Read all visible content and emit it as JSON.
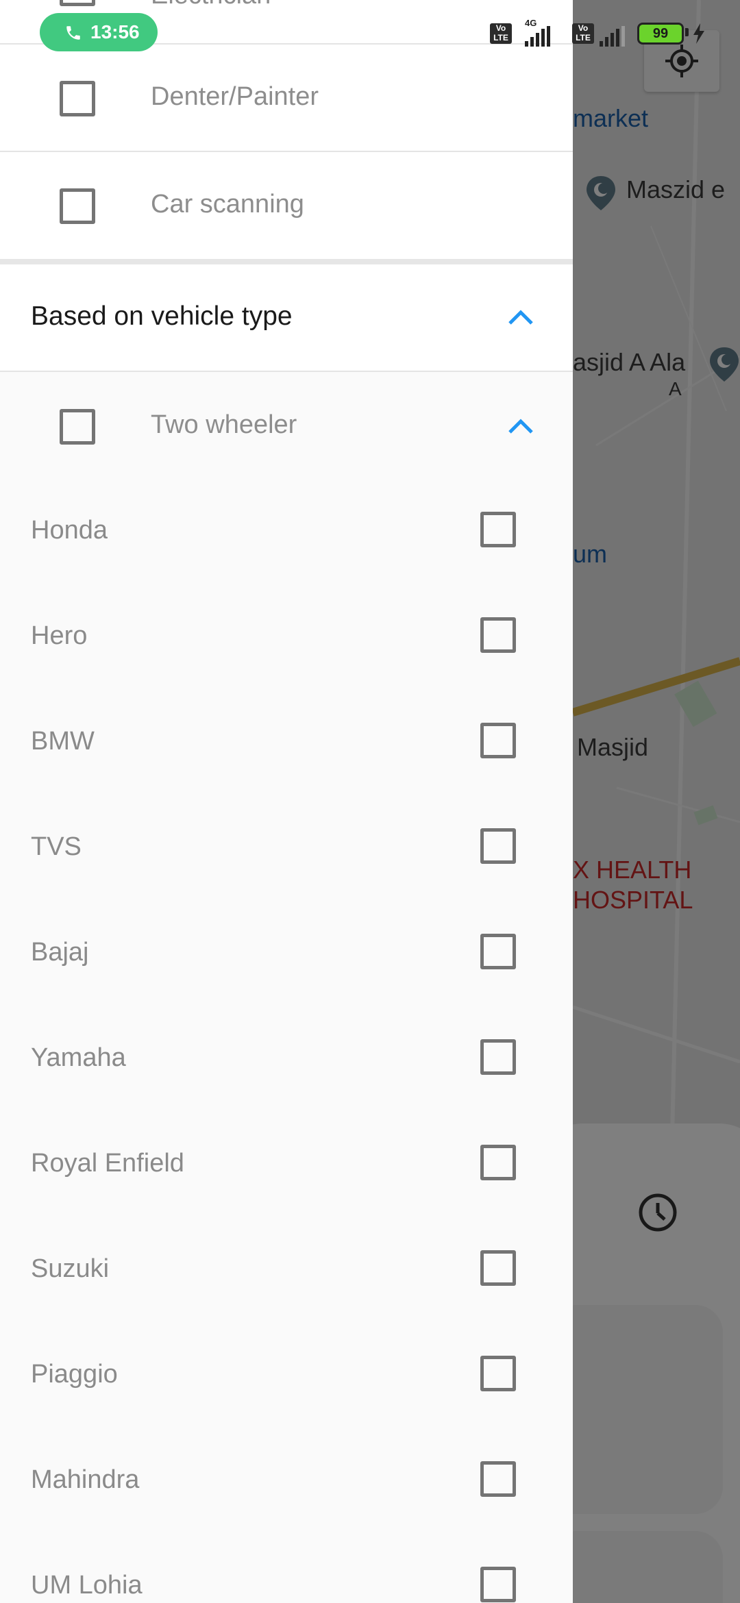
{
  "status_bar": {
    "call_time": "13:56",
    "network_type": "4G",
    "volte_label": "Vo LTE",
    "battery_level": "99"
  },
  "drawer": {
    "top_partial_label": "Electrician",
    "services": [
      {
        "label": "Denter/Painter",
        "checked": false
      },
      {
        "label": "Car scanning",
        "checked": false
      }
    ],
    "vehicle_section": {
      "title": "Based on vehicle type",
      "expanded": true
    },
    "vehicle_types": [
      {
        "label": "Two wheeler",
        "checked": false,
        "expanded": true
      }
    ],
    "brands": [
      {
        "label": "Honda",
        "checked": false
      },
      {
        "label": "Hero",
        "checked": false
      },
      {
        "label": "BMW",
        "checked": false
      },
      {
        "label": "TVS",
        "checked": false
      },
      {
        "label": "Bajaj",
        "checked": false
      },
      {
        "label": "Yamaha",
        "checked": false
      },
      {
        "label": "Royal Enfield",
        "checked": false
      },
      {
        "label": "Suzuki",
        "checked": false
      },
      {
        "label": "Piaggio",
        "checked": false
      },
      {
        "label": "Mahindra",
        "checked": false
      },
      {
        "label": "UM Lohia",
        "checked": false
      }
    ]
  },
  "map": {
    "labels": {
      "market": "market",
      "maszid": "Maszid e",
      "masjid_ala": "asjid A Ala",
      "masjid_ala_2": "A",
      "um": "um",
      "masjid": "Masjid",
      "hospital_1": "X HEALTH",
      "hospital_2": "HOSPITAL"
    }
  },
  "colors": {
    "accent": "#2196f3",
    "call_pill": "#41c980",
    "battery": "#6bd32c",
    "hospital_label": "#c62828",
    "map_poi_blue": "#1b5fa8"
  }
}
